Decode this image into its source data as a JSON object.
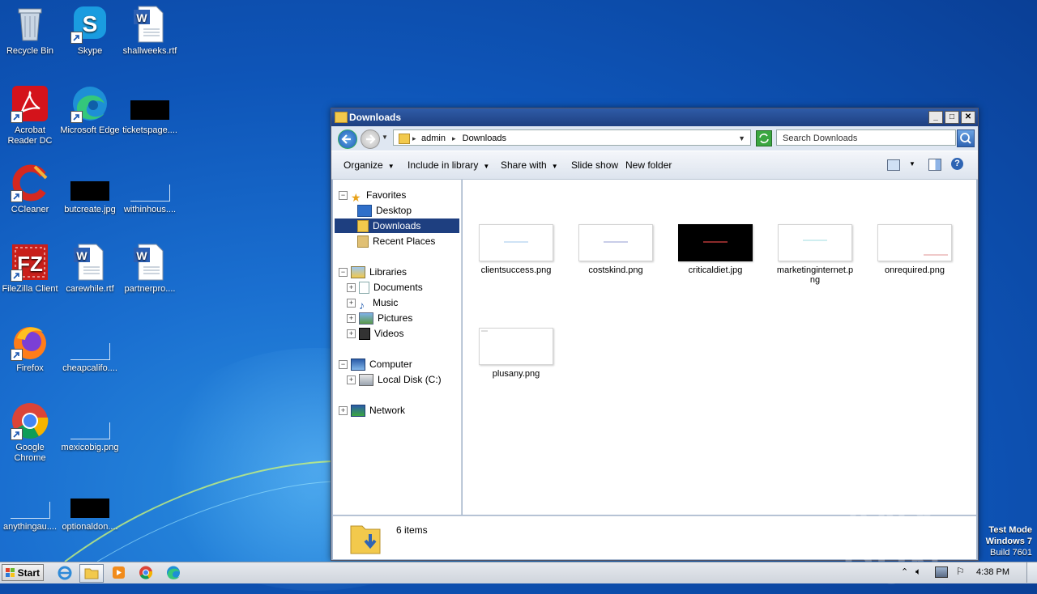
{
  "desktop": {
    "icons": [
      {
        "label": "Recycle Bin",
        "icon": "recycle-bin-icon"
      },
      {
        "label": "Skype",
        "icon": "skype-icon"
      },
      {
        "label": "shallweeks.rtf",
        "icon": "word-document-icon"
      },
      {
        "label": "Acrobat Reader DC",
        "icon": "acrobat-icon"
      },
      {
        "label": "Microsoft Edge",
        "icon": "edge-icon"
      },
      {
        "label": "ticketspage....",
        "icon": "black-thumbnail-icon"
      },
      {
        "label": "CCleaner",
        "icon": "ccleaner-icon"
      },
      {
        "label": "butcreate.jpg",
        "icon": "black-thumbnail-icon"
      },
      {
        "label": "withinhous....",
        "icon": "white-thumbnail-icon"
      },
      {
        "label": "FileZilla Client",
        "icon": "filezilla-icon"
      },
      {
        "label": "carewhile.rtf",
        "icon": "word-document-icon"
      },
      {
        "label": "partnerpro....",
        "icon": "word-document-icon"
      },
      {
        "label": "Firefox",
        "icon": "firefox-icon"
      },
      {
        "label": "cheapcalifo....",
        "icon": "white-thumbnail-icon"
      },
      {
        "label": "Google Chrome",
        "icon": "chrome-icon"
      },
      {
        "label": "mexicobig.png",
        "icon": "white-thumbnail-icon"
      },
      {
        "label": "anythingau....",
        "icon": "white-thumbnail-icon"
      },
      {
        "label": "optionaldon....",
        "icon": "black-thumbnail-icon"
      }
    ]
  },
  "window": {
    "title": "Downloads",
    "minimize": "_",
    "maximize": "□",
    "close": "✕",
    "breadcrumb": [
      "admin",
      "Downloads"
    ],
    "breadcrumb_sep": "▸",
    "search_placeholder": "Search Downloads",
    "toolbar": {
      "organize": "Organize",
      "include_in_library": "Include in library",
      "share_with": "Share with",
      "slide_show": "Slide show",
      "new_folder": "New folder"
    },
    "nav": {
      "favorites": "Favorites",
      "desktop": "Desktop",
      "downloads": "Downloads",
      "recent_places": "Recent Places",
      "libraries": "Libraries",
      "documents": "Documents",
      "music": "Music",
      "pictures": "Pictures",
      "videos": "Videos",
      "computer": "Computer",
      "local_disk": "Local Disk (C:)",
      "network": "Network"
    },
    "files": [
      {
        "name": "clientsuccess.png",
        "thumb": "light"
      },
      {
        "name": "costskind.png",
        "thumb": "light"
      },
      {
        "name": "criticaldiet.jpg",
        "thumb": "dark"
      },
      {
        "name": "marketinginternet.png",
        "thumb": "light"
      },
      {
        "name": "onrequired.png",
        "thumb": "light"
      },
      {
        "name": "plusany.png",
        "thumb": "light"
      }
    ],
    "status": "6 items"
  },
  "taskbar": {
    "start_label": "Start",
    "time": "4:38 PM"
  },
  "watermark": {
    "line1": "Test Mode",
    "line2": "Windows 7",
    "line3": "Build 7601",
    "brand": "ANY RUN"
  },
  "colors": {
    "selection": "#1e3f80",
    "titlebar": "#2f5ca8"
  }
}
